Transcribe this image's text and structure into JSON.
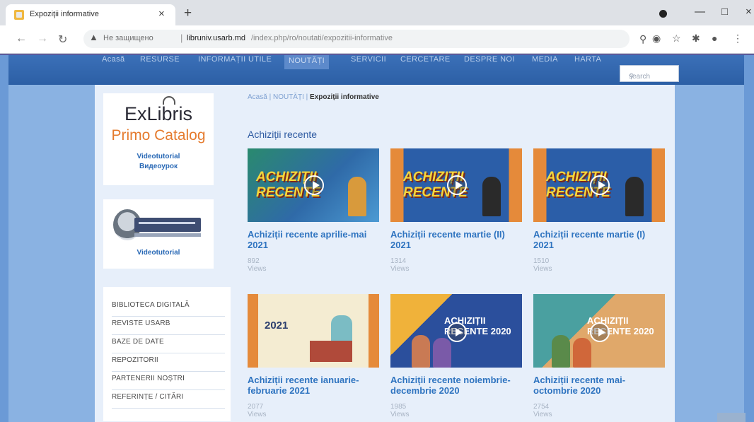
{
  "browser": {
    "tab_title": "Expoziţii informative",
    "tab_close": "×",
    "new_tab": "+",
    "security_label": "Не защищено",
    "url_host": "libruniv.usarb.md",
    "url_path": "/index.php/ro/noutati/expozitii-informative",
    "window_controls": [
      "—",
      "□",
      "×"
    ],
    "toolbar_icons": [
      "search-icon",
      "eye-off-icon",
      "star-icon",
      "puzzle-icon",
      "profile-icon",
      "menu-icon"
    ]
  },
  "site": {
    "nav_items": [
      "Acasă",
      "RESURSE",
      "INFORMAȚII UTILE",
      "NOUTĂȚI",
      "SERVICII",
      "CERCETARE",
      "DESPRE NOI",
      "MEDIA",
      "HARTA"
    ],
    "active_nav": "NOUTĂȚI",
    "search_placeholder": "search"
  },
  "sidebar": {
    "exlibris": {
      "logo": "ExLibris",
      "catalog": "Primo Catalog",
      "link1": "Videotutorial",
      "link2": "Видеоурок"
    },
    "orauser": {
      "link": "Videotutorial"
    },
    "menu": [
      "BIBLIOTECA DIGITALĂ",
      "REVISTE USARB",
      "BAZE DE DATE",
      "REPOZITORII",
      "PARTENERII NOȘTRI",
      "REFERINȚE / CITĂRI"
    ]
  },
  "main": {
    "breadcrumb": {
      "home": "Acasă",
      "sep": "|",
      "parent": "NOUTĂȚI",
      "current": "Expoziții informative"
    },
    "section_title": "Achiziții recente",
    "cards": [
      {
        "title": "Achiziții recente aprilie-mai 2021",
        "views": "892 Views",
        "thumb_text": "ACHIZIȚII RECENTE"
      },
      {
        "title": "Achiziții recente martie (II) 2021",
        "views": "1314 Views",
        "thumb_text": "ACHIZIȚII RECENTE"
      },
      {
        "title": "Achiziții recente martie (I) 2021",
        "views": "1510 Views",
        "thumb_text": "ACHIZIȚII RECENTE"
      },
      {
        "title": "Achiziții recente ianuarie-februarie 2021",
        "views": "2077 Views",
        "thumb_text": "2021"
      },
      {
        "title": "Achiziții recente noiembrie-decembrie 2020",
        "views": "1985 Views",
        "thumb_text": "ACHIZIȚII RECENTE 2020"
      },
      {
        "title": "Achiziții recente mai-octombrie 2020",
        "views": "2754 Views",
        "thumb_text": "ACHIZIȚII RECENTE 2020"
      }
    ]
  },
  "colors": {
    "link_blue": "#2f74c0",
    "nav_bar": "#2c5fa5",
    "page_bg": "#6b9ad6",
    "content_bg": "#e7effa",
    "primo_orange": "#e57b2e"
  }
}
